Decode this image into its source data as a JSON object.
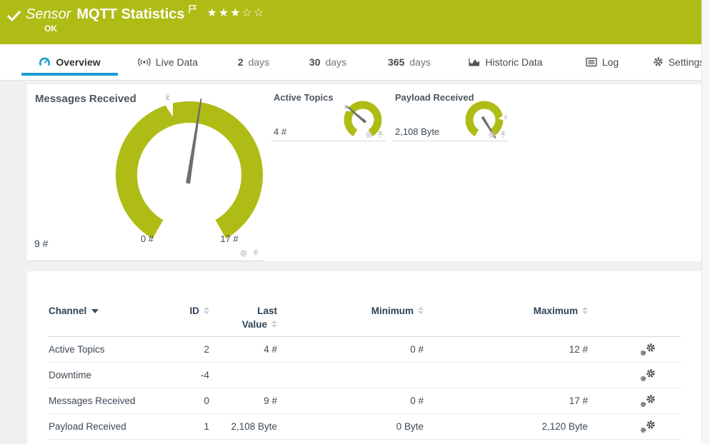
{
  "colors": {
    "brand_green": "#afbc15",
    "accent_blue": "#1d9ad2",
    "needle_gray": "#6e6e6e"
  },
  "header": {
    "kind": "Sensor",
    "title": "MQTT Statistics",
    "status": "OK",
    "stars_filled": "★★★",
    "stars_empty": "☆☆"
  },
  "tabs": {
    "overview": "Overview",
    "live_data": "Live Data",
    "d2_num": "2",
    "d2_label": "days",
    "d30_num": "30",
    "d30_label": "days",
    "d365_num": "365",
    "d365_label": "days",
    "historic": "Historic Data",
    "log": "Log",
    "settings": "Settings"
  },
  "widgets": {
    "messages_received": {
      "title": "Messages Received",
      "value_label": "9 #",
      "min_label": "0 #",
      "max_label": "17 #",
      "min_value": 0,
      "max_value": 17,
      "current_value": 9,
      "mean_fraction": 0.447,
      "mean_symbol": "x̄"
    },
    "active_topics": {
      "title": "Active Topics",
      "value_label": "4 #",
      "min_value": 0,
      "max_value": 12,
      "current_value": 4,
      "mean_fraction": 0.32,
      "mean_symbol": "x̄"
    },
    "payload_received": {
      "title": "Payload Received",
      "value_label": "2,108 Byte",
      "min_value": 0,
      "max_value": 2120,
      "current_value": 2108,
      "mean_fraction": 0.78,
      "mean_symbol": "x̄"
    }
  },
  "table": {
    "headers": {
      "channel": "Channel",
      "id": "ID",
      "last_line1": "Last",
      "last_line2": "Value",
      "minimum": "Minimum",
      "maximum": "Maximum"
    },
    "rows": [
      {
        "channel": "Active Topics",
        "id": "2",
        "last": "4 #",
        "min": "0 #",
        "max": "12 #"
      },
      {
        "channel": "Downtime",
        "id": "-4",
        "last": "",
        "min": "",
        "max": ""
      },
      {
        "channel": "Messages Received",
        "id": "0",
        "last": "9 #",
        "min": "0 #",
        "max": "17 #"
      },
      {
        "channel": "Payload Received",
        "id": "1",
        "last": "2,108 Byte",
        "min": "0 Byte",
        "max": "2,120 Byte"
      }
    ]
  }
}
